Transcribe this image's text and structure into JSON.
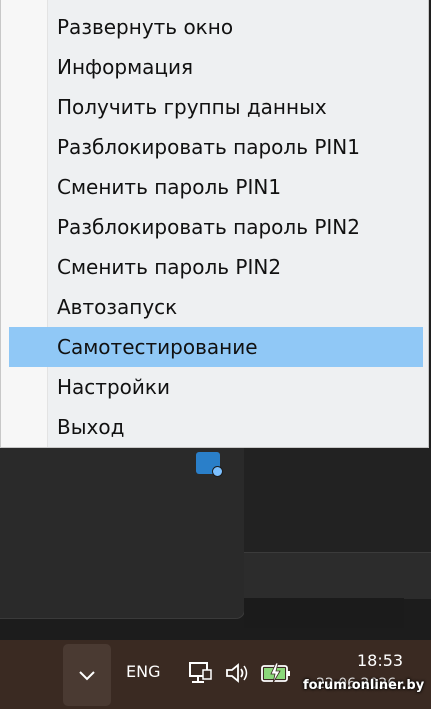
{
  "menu": {
    "items": [
      {
        "label": "Развернуть окно"
      },
      {
        "label": "Информация"
      },
      {
        "label": "Получить группы данных"
      },
      {
        "label": "Разблокировать пароль PIN1"
      },
      {
        "label": "Сменить пароль PIN1"
      },
      {
        "label": "Разблокировать пароль PIN2"
      },
      {
        "label": "Сменить пароль PIN2"
      },
      {
        "label": "Автозапуск"
      },
      {
        "label": "Самотестирование",
        "highlighted": true
      },
      {
        "label": "Настройки"
      },
      {
        "label": "Выход"
      }
    ],
    "highlight_color": "#90c8f6"
  },
  "taskbar": {
    "language": "ENG",
    "time": "18:53",
    "date": "22.06.2026",
    "icons": [
      "chevron-up-icon",
      "network-icon",
      "speaker-icon",
      "battery-charging-icon"
    ]
  },
  "watermark": "forum.onliner.by"
}
